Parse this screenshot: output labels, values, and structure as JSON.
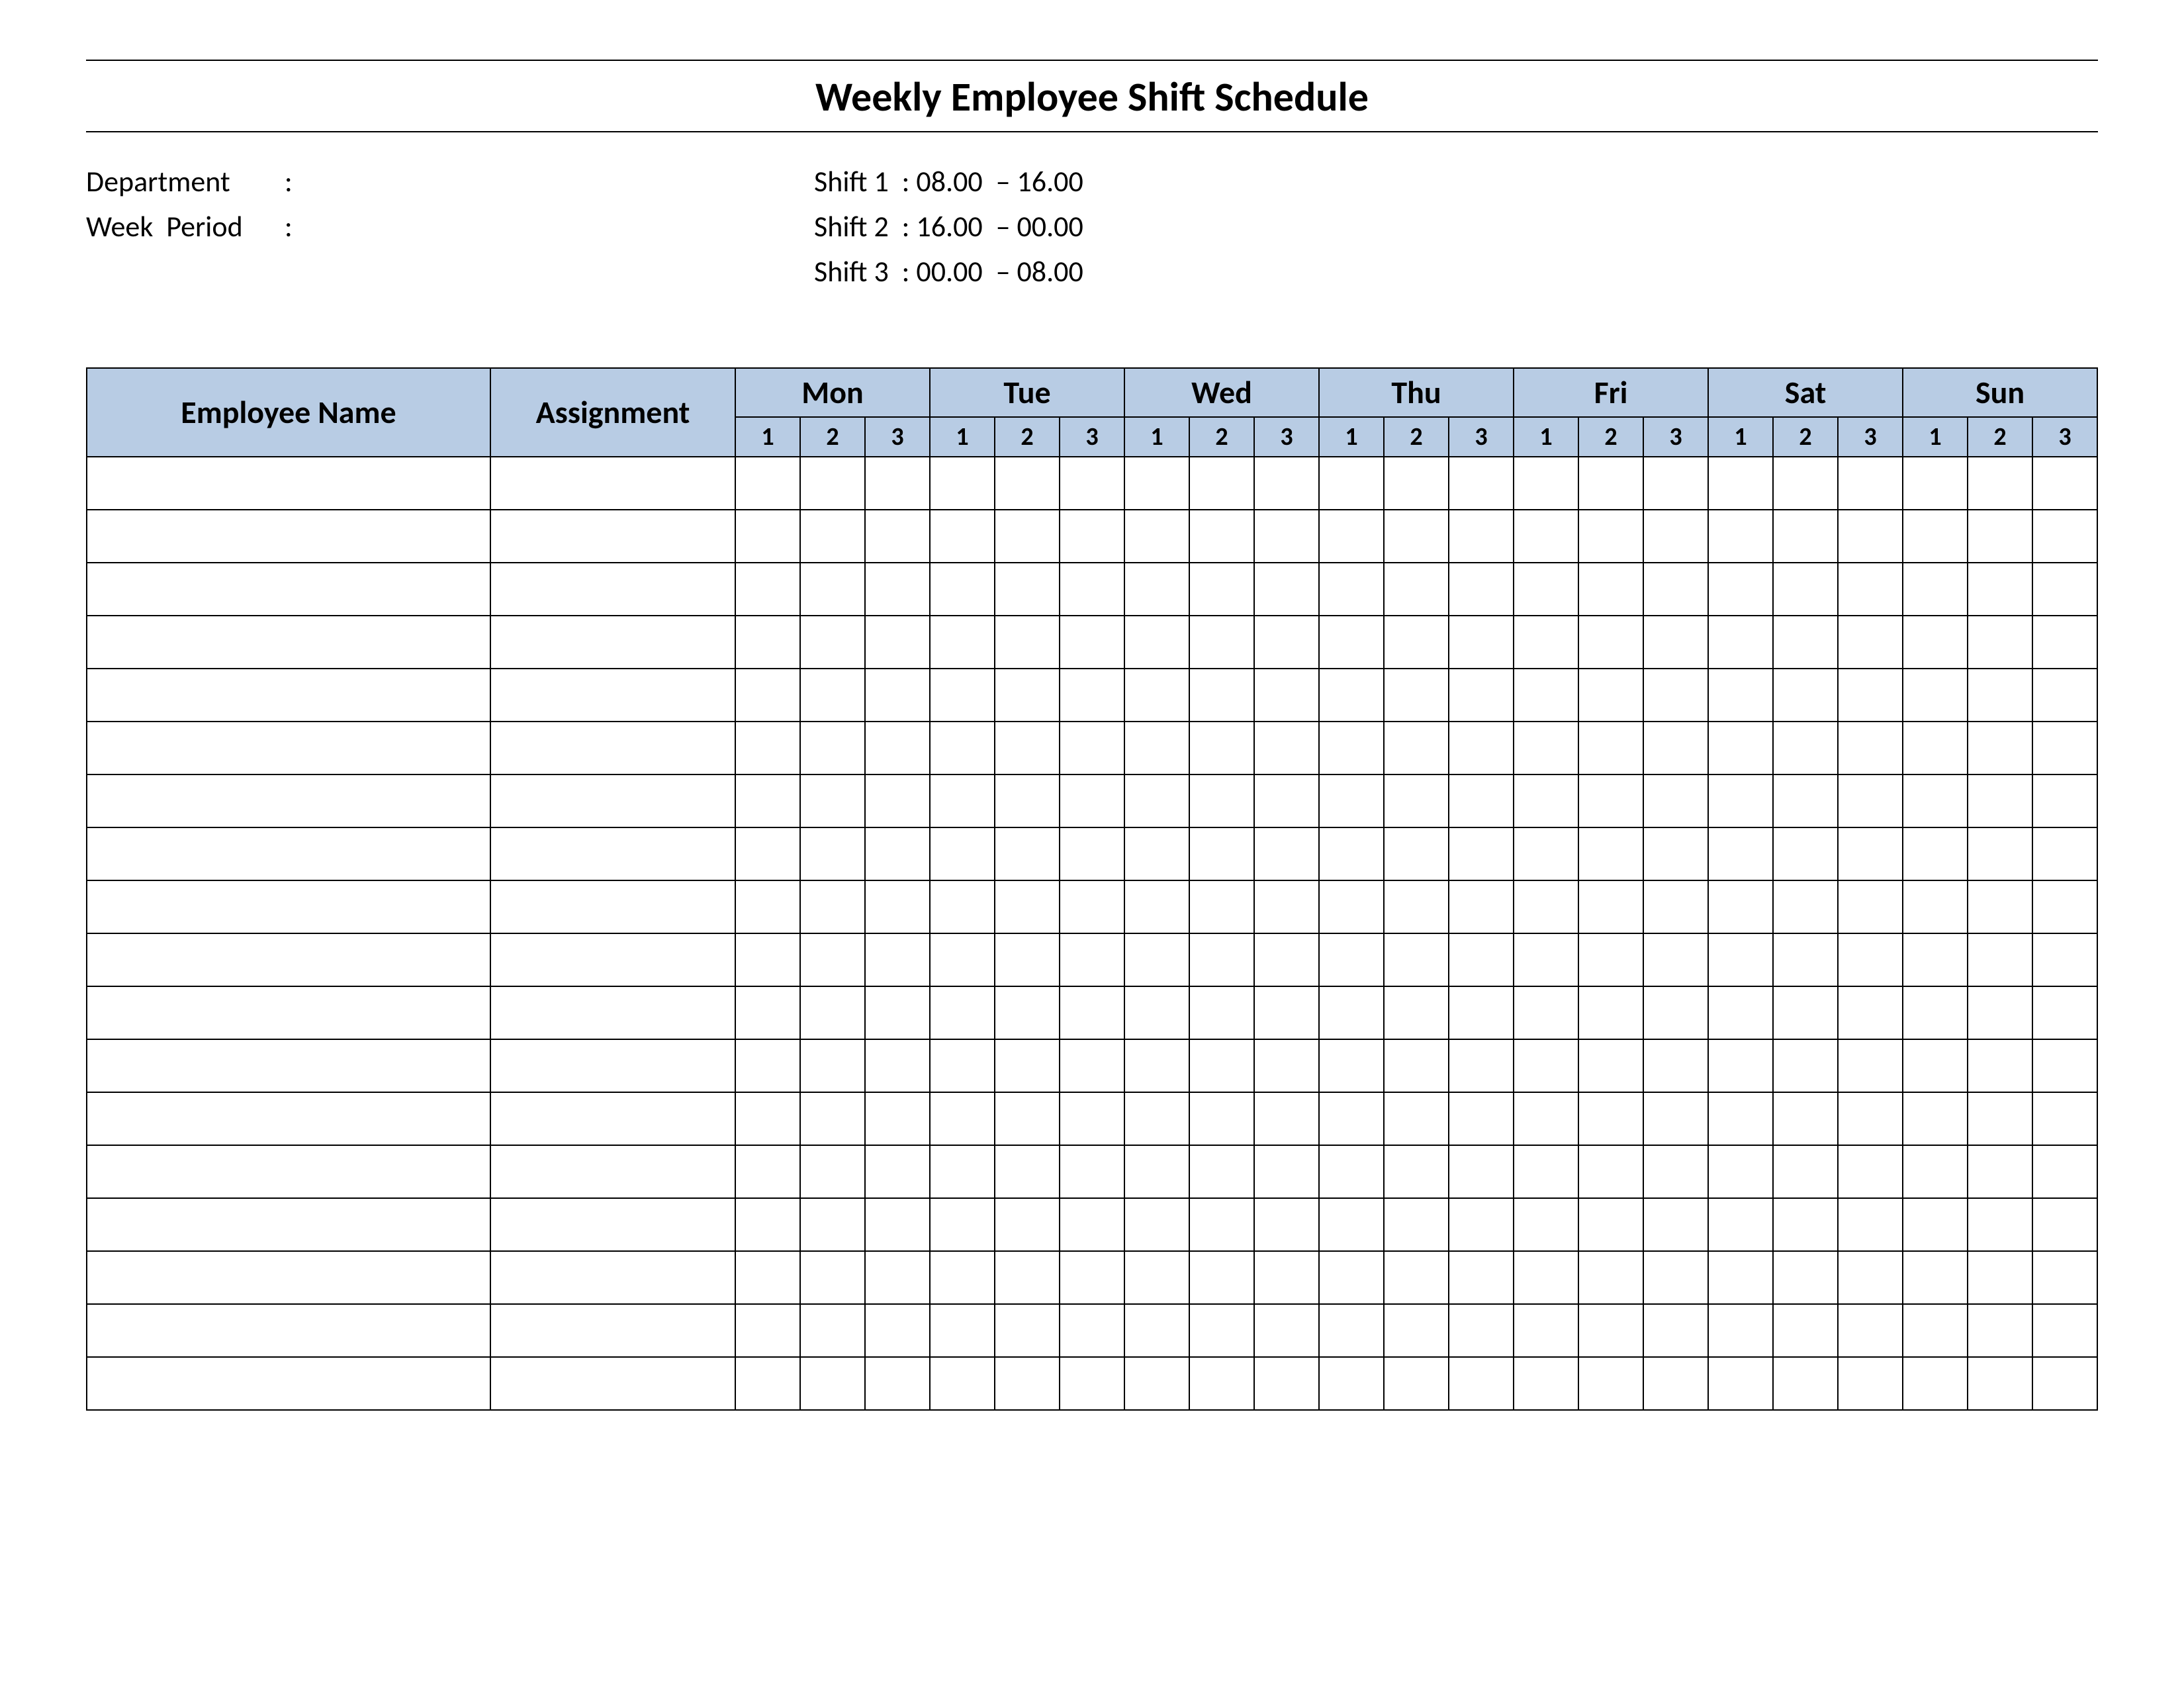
{
  "title": "Weekly Employee Shift Schedule",
  "meta": {
    "department_label": "Department",
    "department_value": "",
    "week_label": "Week  Period",
    "week_value": "",
    "shift1_label": "Shift 1",
    "shift1_value": "08.00  – 16.00",
    "shift2_label": "Shift 2",
    "shift2_value": "16.00  – 00.00",
    "shift3_label": "Shift 3",
    "shift3_value": "00.00  – 08.00"
  },
  "headers": {
    "employee": "Employee Name",
    "assignment": "Assignment",
    "days": [
      "Mon",
      "Tue",
      "Wed",
      "Thu",
      "Fri",
      "Sat",
      "Sun"
    ],
    "shifts": [
      "1",
      "2",
      "3"
    ]
  },
  "row_count": 18
}
